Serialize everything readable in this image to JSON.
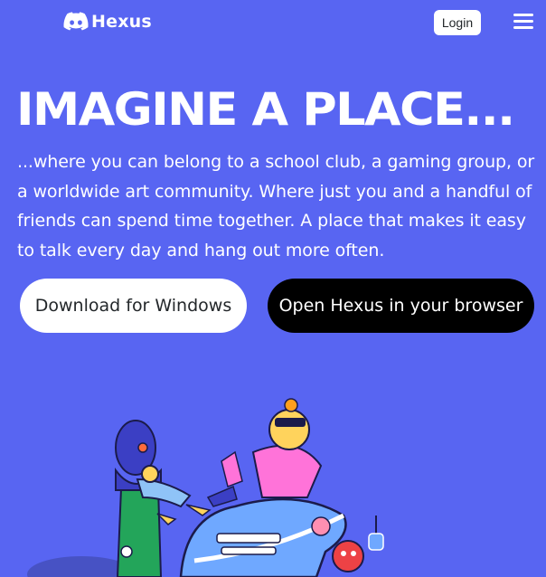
{
  "header": {
    "brand": "Hexus",
    "login_label": "Login"
  },
  "hero": {
    "title": "IMAGINE A PLACE...",
    "description": "...where you can belong to a school club, a gaming group, or a worldwide art community. Where just you and a handful of friends can spend time together. A place that makes it easy to talk every day and hang out more often.",
    "download_label": "Download for Windows",
    "browser_label": "Open Hexus in your browser"
  },
  "icons": {
    "logo": "game-controller-icon",
    "menu": "hamburger-menu-icon"
  },
  "colors": {
    "background": "#5865F2",
    "primary_button": "#FFFFFF",
    "secondary_button": "#000000"
  }
}
